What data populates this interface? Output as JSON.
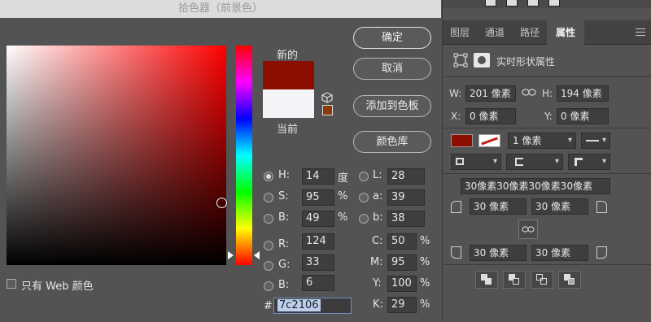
{
  "dialog": {
    "title": "拾色器（前景色）",
    "new_label": "新的",
    "current_label": "当前",
    "new_color": "#8c0e00",
    "current_color": "#f4f3f7",
    "buttons": {
      "ok": "确定",
      "cancel": "取消",
      "add_to_swatches": "添加到色板",
      "color_libraries": "颜色库"
    },
    "fields": {
      "H": {
        "label": "H:",
        "value": "14",
        "unit": "度"
      },
      "S": {
        "label": "S:",
        "value": "95",
        "unit": "%"
      },
      "B": {
        "label": "B:",
        "value": "49",
        "unit": "%"
      },
      "R": {
        "label": "R:",
        "value": "124"
      },
      "G": {
        "label": "G:",
        "value": "33"
      },
      "Bl": {
        "label": "B:",
        "value": "6"
      },
      "L": {
        "label": "L:",
        "value": "28"
      },
      "a": {
        "label": "a:",
        "value": "39"
      },
      "b": {
        "label": "b:",
        "value": "38"
      },
      "C": {
        "label": "C:",
        "value": "50",
        "unit": "%"
      },
      "M": {
        "label": "M:",
        "value": "95",
        "unit": "%"
      },
      "Y": {
        "label": "Y:",
        "value": "100",
        "unit": "%"
      },
      "K": {
        "label": "K:",
        "value": "29",
        "unit": "%"
      }
    },
    "hex_label": "#",
    "hex_value": "7c2106",
    "web_only_label": "只有 Web 颜色"
  },
  "panel": {
    "tabs": [
      "图层",
      "通道",
      "路径",
      "属性"
    ],
    "active_tab": "属性",
    "header_label": "实时形状属性",
    "w_label": "W:",
    "w_value": "201 像素",
    "h_label": "H:",
    "h_value": "194 像素",
    "x_label": "X:",
    "x_value": "0 像素",
    "y_label": "Y:",
    "y_value": "0 像素",
    "fill_color": "#8c0e00",
    "stroke_width": "1 像素",
    "corner_summary": "30像素30像素30像素30像素",
    "corner_tl": "30 像素",
    "corner_tr": "30 像素",
    "corner_bl": "30 像素",
    "corner_br": "30 像素"
  }
}
